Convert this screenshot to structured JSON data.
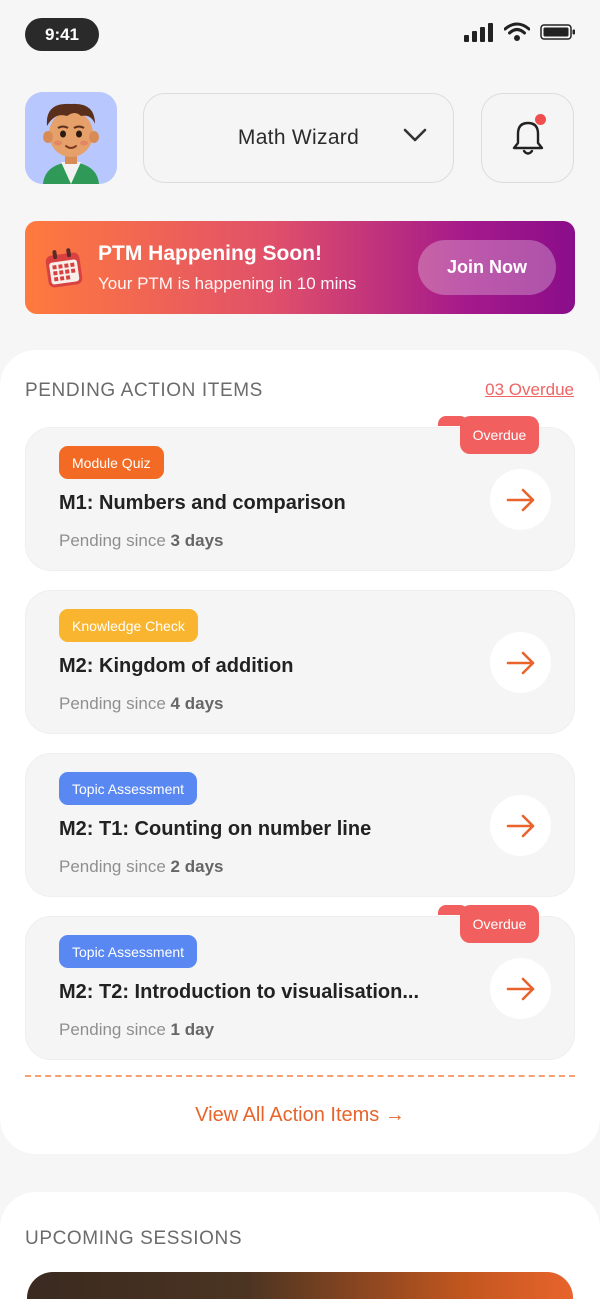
{
  "status_bar": {
    "time": "9:41"
  },
  "header": {
    "selected_class": "Math Wizard",
    "has_notification": true
  },
  "banner": {
    "title": "PTM Happening Soon!",
    "subtitle": "Your PTM is happening in 10 mins",
    "cta": "Join Now"
  },
  "pending": {
    "title": "PENDING ACTION ITEMS",
    "overdue_link": "03 Overdue",
    "items": [
      {
        "tag": "Module Quiz",
        "tag_color": "#f26a23",
        "title": "M1: Numbers and comparison",
        "pending_prefix": "Pending since",
        "pending_value": "3 days",
        "overdue": "Overdue"
      },
      {
        "tag": "Knowledge Check",
        "tag_color": "#f9b52f",
        "title": "M2: Kingdom of addition",
        "pending_prefix": "Pending since",
        "pending_value": "4 days"
      },
      {
        "tag": "Topic Assessment",
        "tag_color": "#5a88f2",
        "title": "M2: T1: Counting on number line",
        "pending_prefix": "Pending since",
        "pending_value": "2 days"
      },
      {
        "tag": "Topic Assessment",
        "tag_color": "#5a88f2",
        "title": "M2: T2: Introduction to visualisation...",
        "pending_prefix": "Pending since",
        "pending_value": "1 day",
        "overdue": "Overdue"
      }
    ],
    "view_all": "View All Action Items →"
  },
  "upcoming": {
    "title": "UPCOMING SESSIONS"
  },
  "colors": {
    "accent": "#e8642c",
    "overdue": "#f25f5f",
    "background": "#f6f6f6"
  }
}
